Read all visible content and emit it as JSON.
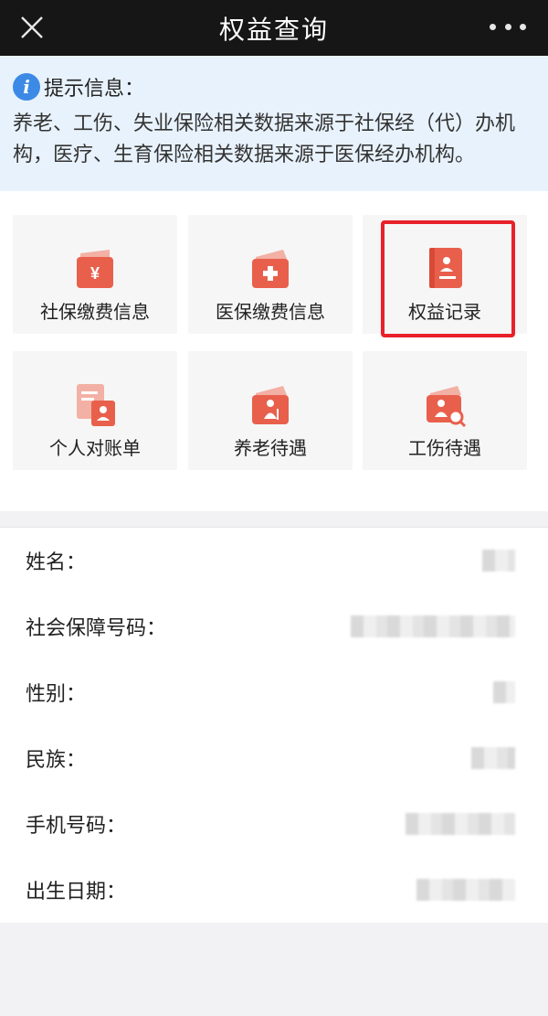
{
  "topbar": {
    "title": "权益查询",
    "close_icon": "close-icon",
    "more_icon": "more-dots-icon"
  },
  "notice": {
    "icon": "info-icon",
    "icon_glyph": "i",
    "label": "提示信息：",
    "text": "养老、工伤、失业保险相关数据来源于社保经（代）办机构，医疗、生育保险相关数据来源于医保经办机构。"
  },
  "tiles": [
    {
      "label": "社保缴费信息",
      "icon": "yen-wallet-icon"
    },
    {
      "label": "医保缴费信息",
      "icon": "medical-wallet-icon"
    },
    {
      "label": "权益记录",
      "icon": "record-book-icon"
    },
    {
      "label": "个人对账单",
      "icon": "statement-icon"
    },
    {
      "label": "养老待遇",
      "icon": "elderly-icon"
    },
    {
      "label": "工伤待遇",
      "icon": "injury-search-icon"
    }
  ],
  "colors": {
    "topbar": "#161616",
    "notice_bg": "#e8f2fc",
    "info_blue": "#3c8ae6",
    "icon_red": "#e8604c",
    "highlight": "#e8212a"
  },
  "profile": {
    "name_label": "姓名：",
    "ssn_label": "社会保障号码：",
    "gender_label": "性别：",
    "ethnicity_label": "民族：",
    "phone_label": "手机号码：",
    "birth_label": "出生日期："
  }
}
